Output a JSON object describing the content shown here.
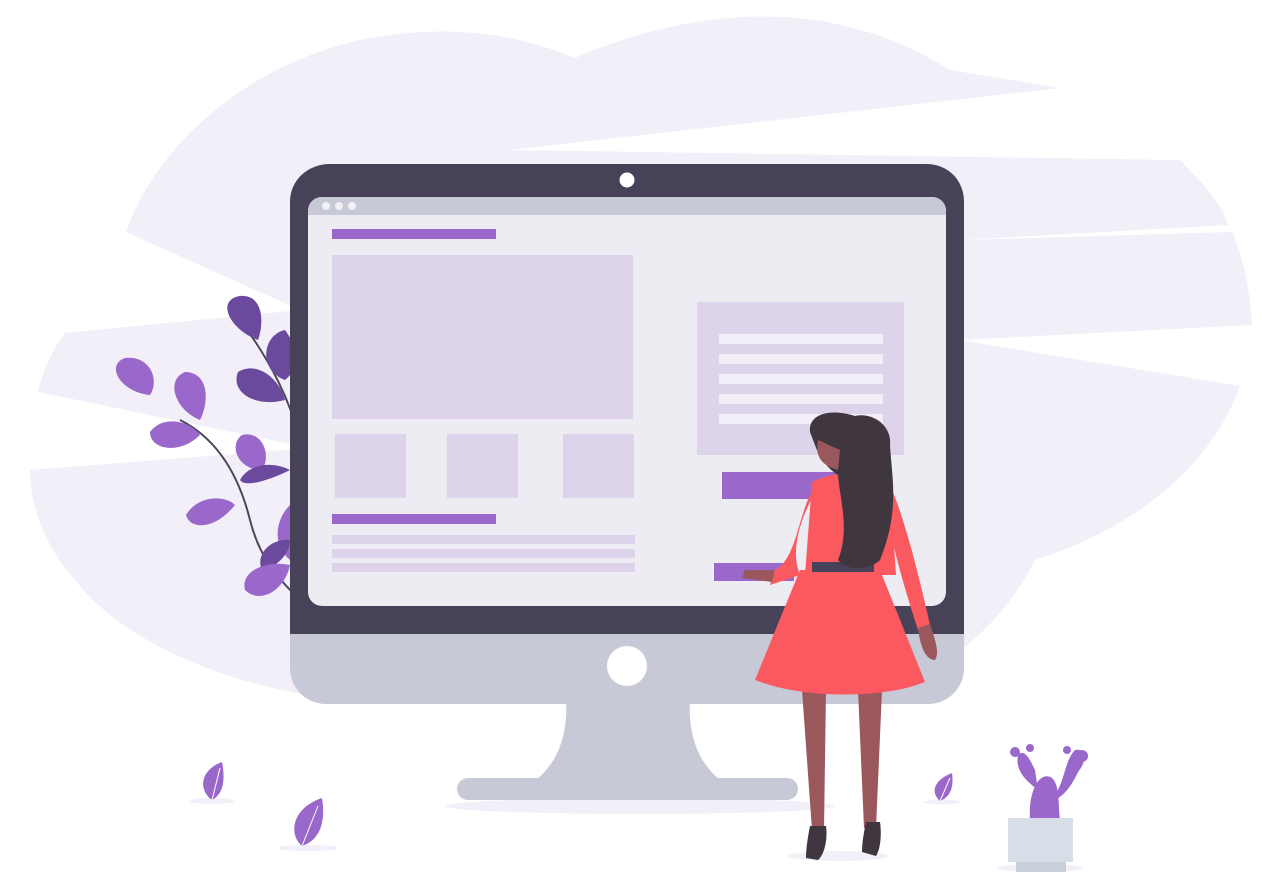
{
  "illustration": {
    "screen": {
      "window_dots": 3,
      "thumbnail_count": 3,
      "list_line_count": 5,
      "text_line_count": 3
    },
    "colors": {
      "background_blob": "#f3eff9",
      "monitor_frame": "#484258",
      "monitor_chin": "#c8c9d6",
      "screen_bg": "#ececf2",
      "titlebar": "#c8c9d6",
      "accent": "#9a67cb",
      "panel": "#ddd3ea",
      "leaf_dark": "#6b4a9e",
      "leaf_light": "#9a67cb",
      "dress": "#fa5a5f",
      "skin": "#9b585c",
      "hair": "#3f3640",
      "pot": "#d8dee8"
    }
  }
}
